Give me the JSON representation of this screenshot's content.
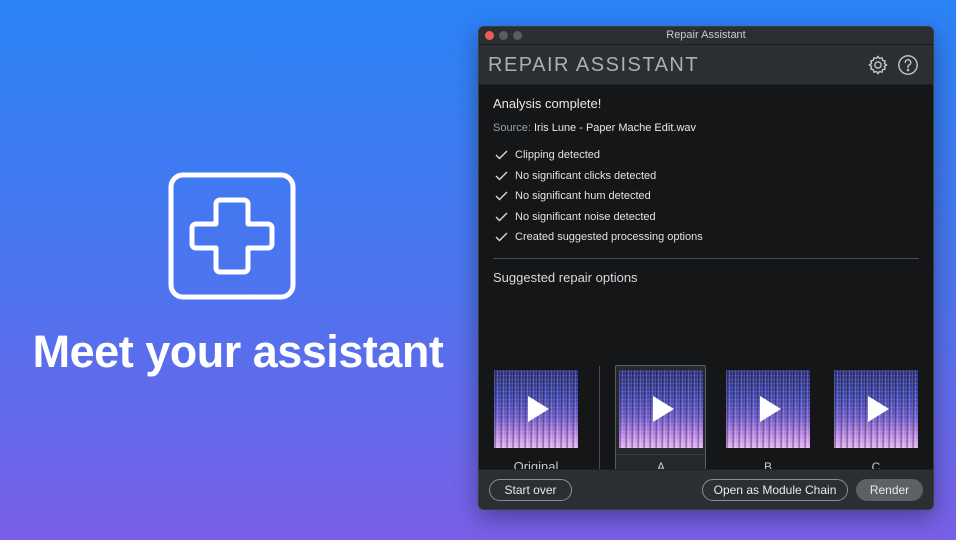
{
  "hero": {
    "icon": "plus-cross-icon",
    "title": "Meet your assistant"
  },
  "window": {
    "title": "Repair Assistant",
    "app_title": "REPAIR ASSISTANT",
    "settings_icon": "gear-icon",
    "help_icon": "help-icon"
  },
  "analysis": {
    "heading": "Analysis complete!",
    "source_label": "Source:",
    "source_file": "Iris Lune - Paper Mache Edit.wav",
    "checks": [
      "Clipping detected",
      "No significant clicks detected",
      "No significant hum detected",
      "No significant noise detected",
      "Created suggested processing options"
    ]
  },
  "suggestions": {
    "title": "Suggested repair options",
    "options": [
      {
        "label": "Original"
      },
      {
        "label": "A"
      },
      {
        "label": "B"
      },
      {
        "label": "C"
      }
    ],
    "selected": "A"
  },
  "footer": {
    "start_over": "Start over",
    "open_chain": "Open as Module Chain",
    "render": "Render"
  },
  "colors": {
    "accent_bg_top": "#2a83f6",
    "accent_bg_bottom": "#7a5fe8",
    "window_bg": "#141618",
    "close_button": "#ee5c55"
  }
}
